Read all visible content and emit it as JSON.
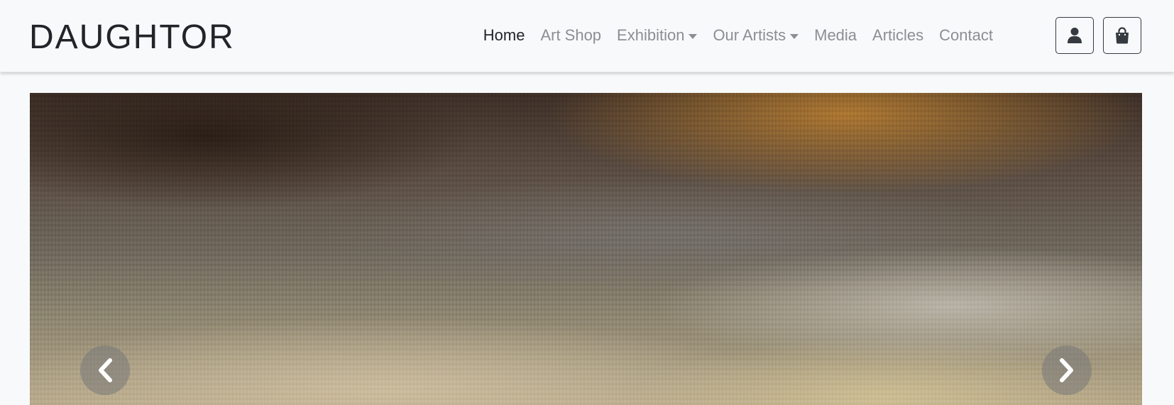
{
  "brand": {
    "name": "DAUGHTOR"
  },
  "nav": {
    "items": [
      {
        "label": "Home",
        "active": true,
        "dropdown": false
      },
      {
        "label": "Art Shop",
        "active": false,
        "dropdown": false
      },
      {
        "label": "Exhibition",
        "active": false,
        "dropdown": true
      },
      {
        "label": "Our Artists",
        "active": false,
        "dropdown": true
      },
      {
        "label": "Media",
        "active": false,
        "dropdown": false
      },
      {
        "label": "Articles",
        "active": false,
        "dropdown": false
      },
      {
        "label": "Contact",
        "active": false,
        "dropdown": false
      }
    ],
    "buttons": [
      {
        "icon": "user-icon"
      },
      {
        "icon": "shopping-bag-icon"
      }
    ]
  },
  "carousel": {
    "controls": {
      "prev_icon": "chevron-left-icon",
      "next_icon": "chevron-right-icon"
    }
  },
  "colors": {
    "background": "#f8f9fa",
    "text_active": "#212529",
    "text_muted": "#8a8f94",
    "button_border": "#343a40"
  }
}
